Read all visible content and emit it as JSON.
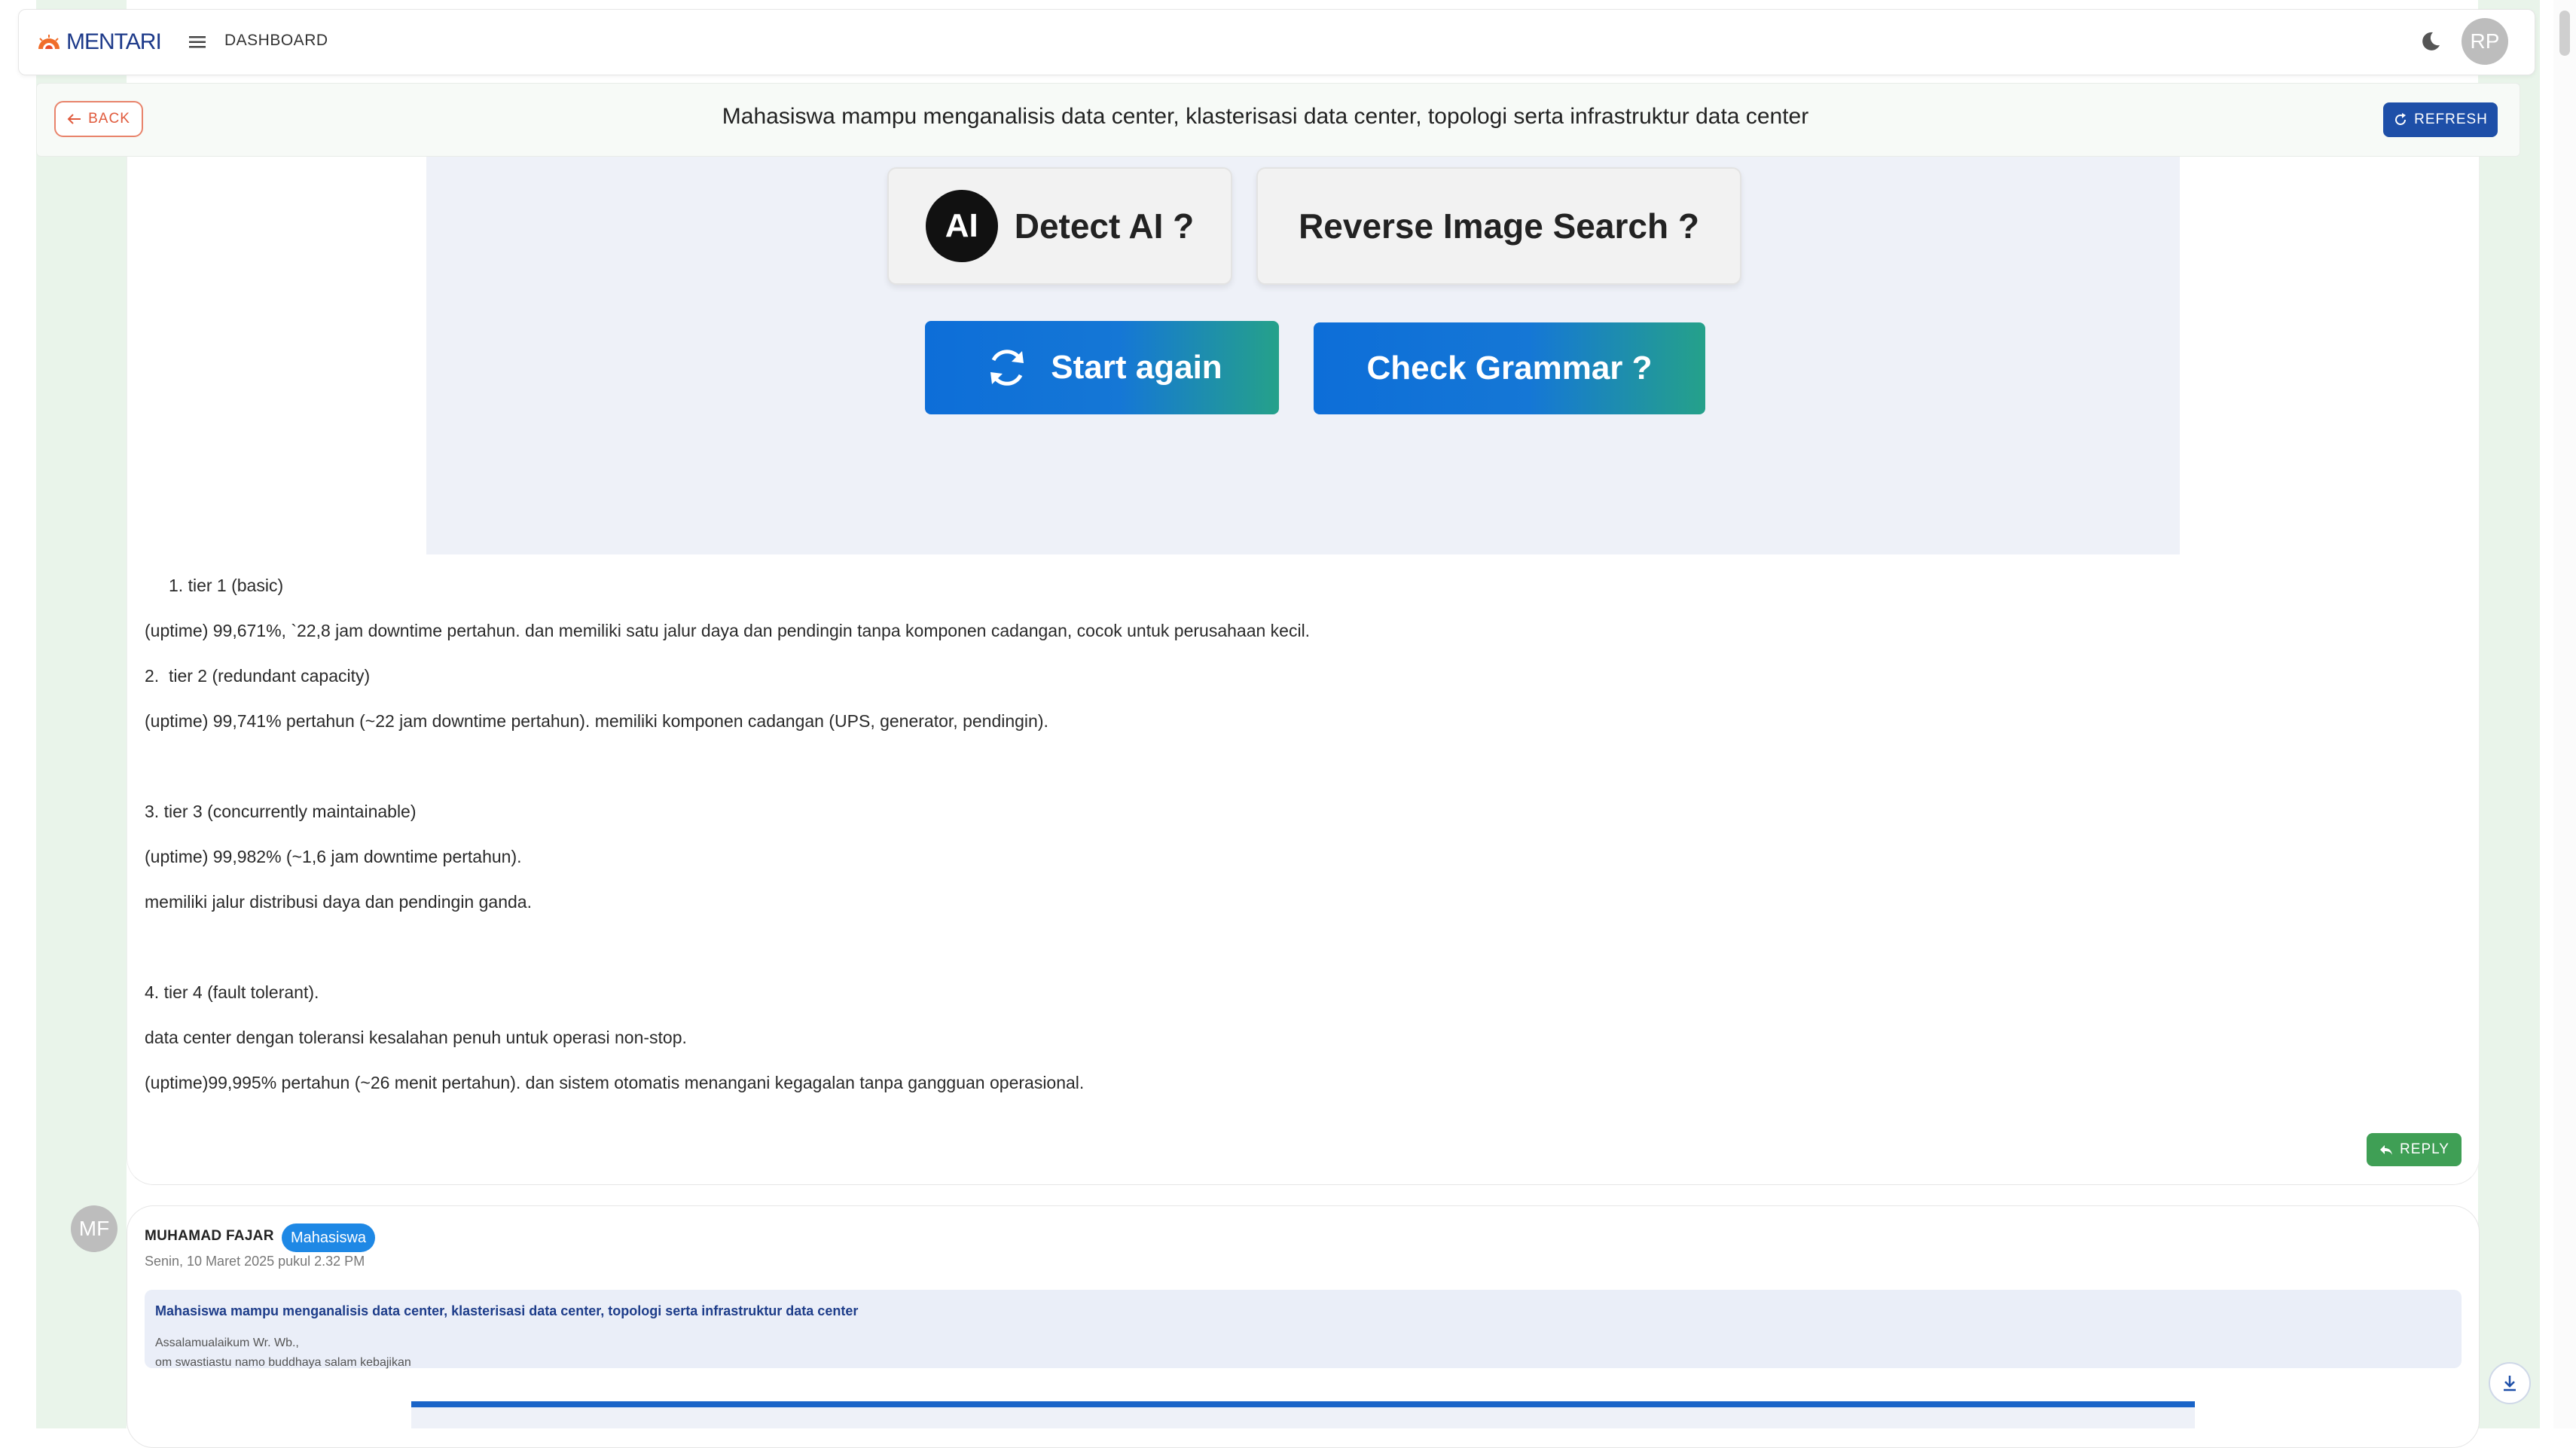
{
  "header": {
    "logo_text": "MENTARI",
    "menu_label": "DASHBOARD",
    "user_initials": "RP"
  },
  "subheader": {
    "back_label": "BACK",
    "title": "Mahasiswa mampu menganalisis data center, klasterisasi data center, topologi serta infrastruktur data center",
    "refresh_label": "REFRESH"
  },
  "embedded_image": {
    "ai_badge": "AI",
    "detect_label": "Detect AI ?",
    "reverse_label": "Reverse Image Search ?",
    "start_label": "Start again",
    "grammar_label": "Check Grammar ?"
  },
  "post": {
    "lines": [
      "1. tier 1 (basic)",
      "(uptime) 99,671%, `22,8 jam downtime pertahun. dan memiliki satu jalur daya dan pendingin tanpa komponen cadangan, cocok untuk perusahaan kecil.",
      "2.  tier 2 (redundant capacity)",
      "(uptime) 99,741% pertahun (~22 jam downtime pertahun). memiliki komponen cadangan (UPS, generator, pendingin).",
      "3. tier 3 (concurrently maintainable)",
      "(uptime) 99,982% (~1,6 jam downtime pertahun).",
      "memiliki jalur distribusi daya dan pendingin ganda.",
      "4. tier 4 (fault tolerant).",
      "data center dengan toleransi kesalahan penuh untuk operasi non-stop.",
      "(uptime)99,995% pertahun (~26 menit pertahun). dan sistem otomatis menangani kegagalan tanpa gangguan operasional."
    ],
    "reply_label": "REPLY"
  },
  "comment": {
    "initials": "MF",
    "author": "MUHAMAD FAJAR",
    "role": "Mahasiswa",
    "timestamp": "Senin, 10 Maret 2025 pukul 2.32 PM",
    "quote_title": "Mahasiswa mampu menganalisis data center, klasterisasi data center, topologi serta infrastruktur data center",
    "quote_line1": "Assalamualaikum Wr. Wb.,",
    "quote_line2": "om swastiastu namo buddhaya salam kebajikan"
  },
  "colors": {
    "brand": "#1d3a8a",
    "accent_green": "#3f9f55",
    "refresh_blue": "#1e4fa8",
    "back_orange": "#e05a3c",
    "badge_blue": "#1e88e5"
  }
}
